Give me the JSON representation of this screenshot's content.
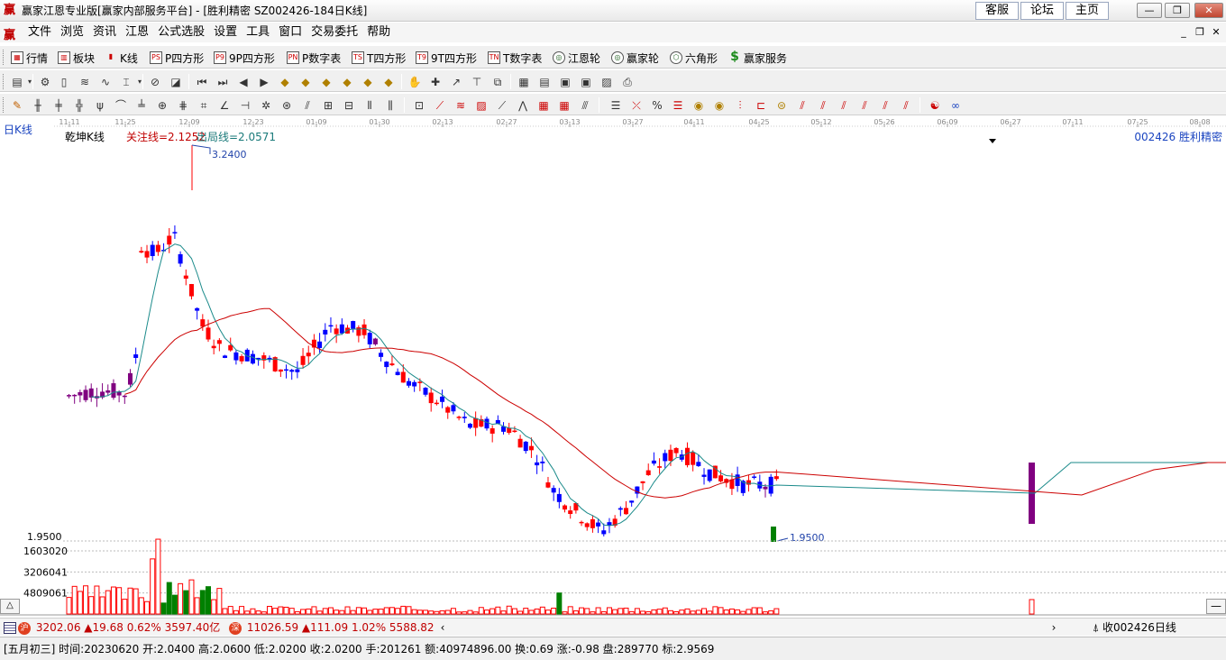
{
  "window": {
    "title": "赢家江恩专业版[赢家内部服务平台] - [胜利精密  SZ002426-184日K线]",
    "links": [
      "客服",
      "论坛",
      "主页"
    ],
    "controls": {
      "minimize": "—",
      "restore": "❐",
      "close": "✕"
    }
  },
  "menu": {
    "items": [
      "文件",
      "浏览",
      "资讯",
      "江恩",
      "公式选股",
      "设置",
      "工具",
      "窗口",
      "交易委托",
      "帮助"
    ],
    "mdi_controls": {
      "minimize": "_",
      "restore": "❐",
      "close": "✕"
    }
  },
  "toolbar1": {
    "items": [
      {
        "label": "行情",
        "icon": "grid-icon"
      },
      {
        "label": "板块",
        "icon": "blocks-icon"
      },
      {
        "label": "K线",
        "icon": "candles-icon"
      },
      {
        "label": "P四方形",
        "icon": "ps-icon",
        "badge": "PS"
      },
      {
        "label": "9P四方形",
        "icon": "p9-icon",
        "badge": "P9"
      },
      {
        "label": "P数字表",
        "icon": "pn-icon",
        "badge": "PN"
      },
      {
        "label": "T四方形",
        "icon": "ts-icon",
        "badge": "TS"
      },
      {
        "label": "9T四方形",
        "icon": "t9-icon",
        "badge": "T9"
      },
      {
        "label": "T数字表",
        "icon": "tn-icon",
        "badge": "TN"
      },
      {
        "label": "江恩轮",
        "icon": "gann-wheel-icon"
      },
      {
        "label": "赢家轮",
        "icon": "winner-wheel-icon"
      },
      {
        "label": "六角形",
        "icon": "hexagon-icon"
      },
      {
        "label": "赢家服务",
        "icon": "dollar-icon"
      }
    ]
  },
  "chart": {
    "period_label": "日K线",
    "indicator_name": "乾坤K线",
    "focus_line": "关注线=2.1252",
    "exit_line": "出局线=2.0571",
    "stock_label": "002426  胜利精密",
    "high_label": "3.2400",
    "low_label": "1.9500",
    "axis_price_label": "1.9500",
    "volume_ticks": [
      "4809061",
      "3206041",
      "1603020"
    ],
    "left_tab": "△",
    "right_tab": "—"
  },
  "chart_data": {
    "type": "candlestick",
    "x_ticks": [
      "11-11",
      "11-25",
      "12-09",
      "12-23",
      "01-09",
      "01-30",
      "02-13",
      "02-27",
      "03-13",
      "03-27",
      "04-11",
      "04-25",
      "05-12",
      "05-26",
      "06-09",
      "06-27",
      "07-11",
      "07-25",
      "08-08"
    ],
    "price_high": 3.24,
    "price_low": 1.95,
    "focus_line": 2.1252,
    "exit_line": 2.0571,
    "volume_levels": [
      1603020,
      3206041,
      4809061
    ],
    "colors": {
      "up": "#ff0000",
      "down": "#0000ff",
      "neutral": "#800080",
      "volume_up": "#ff0000",
      "volume_down": "#008000",
      "ma_short": "#1a8a8a",
      "ma_long": "#cc0000"
    }
  },
  "indexbar": {
    "sh_value": "3202.06",
    "sh_change": "▲19.68",
    "sh_pct": "0.62%",
    "sh_amount": "3597.40亿",
    "sz_value": "11026.59",
    "sz_change": "▲111.09",
    "sz_pct": "1.02%",
    "sz_amount": "5588.82",
    "right_text": "收002426日线"
  },
  "infobar": {
    "text": "[五月初三] 时间:20230620 开:2.0400 高:2.0600 低:2.0200 收:2.0200 手:201261 额:40974896.00 换:0.69 涨:-0.98 盘:289770 标:2.9569"
  }
}
